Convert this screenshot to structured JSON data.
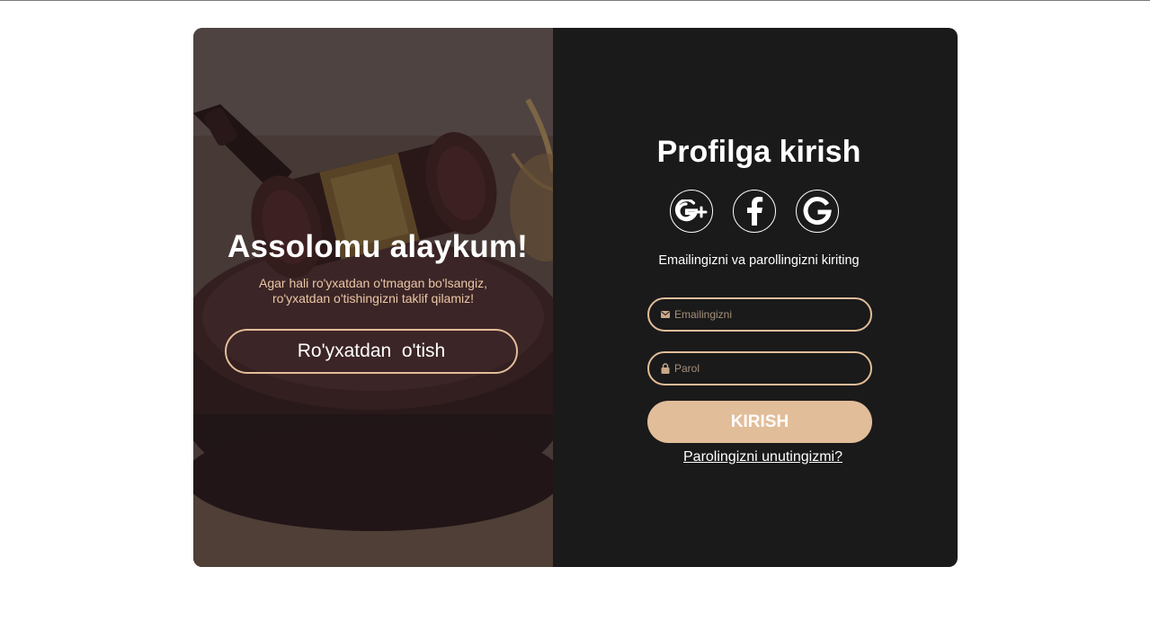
{
  "left_panel": {
    "title": "Assolomu alaykum!",
    "subtitle_line1": "Agar hali ro'yxatdan o'tmagan bo'lsangiz,",
    "subtitle_line2": "ro'yxatdan o'tishingizni taklif qilamiz!",
    "signup_button": "Ro'yxatdan  o'tish",
    "background_image": "gavel-photo"
  },
  "right_panel": {
    "title": "Profilga kirish",
    "social": [
      {
        "icon": "google-plus-icon",
        "label": "G+"
      },
      {
        "icon": "facebook-icon",
        "label": "f"
      },
      {
        "icon": "google-icon",
        "label": "G"
      }
    ],
    "hint": "Emailingizni va parollingizni kiriting",
    "email": {
      "placeholder": "Emailingizni",
      "value": "",
      "icon": "envelope-icon"
    },
    "password": {
      "placeholder": "Parol",
      "value": "",
      "icon": "lock-icon"
    },
    "login_button": "KIRISH",
    "forgot_link": "Parolingizni unutingizmi?"
  },
  "colors": {
    "accent": "#e2bd99",
    "dark_panel": "#1a1a1a",
    "page_bg": "#ffffff",
    "subtitle": "#e9c7a6"
  }
}
